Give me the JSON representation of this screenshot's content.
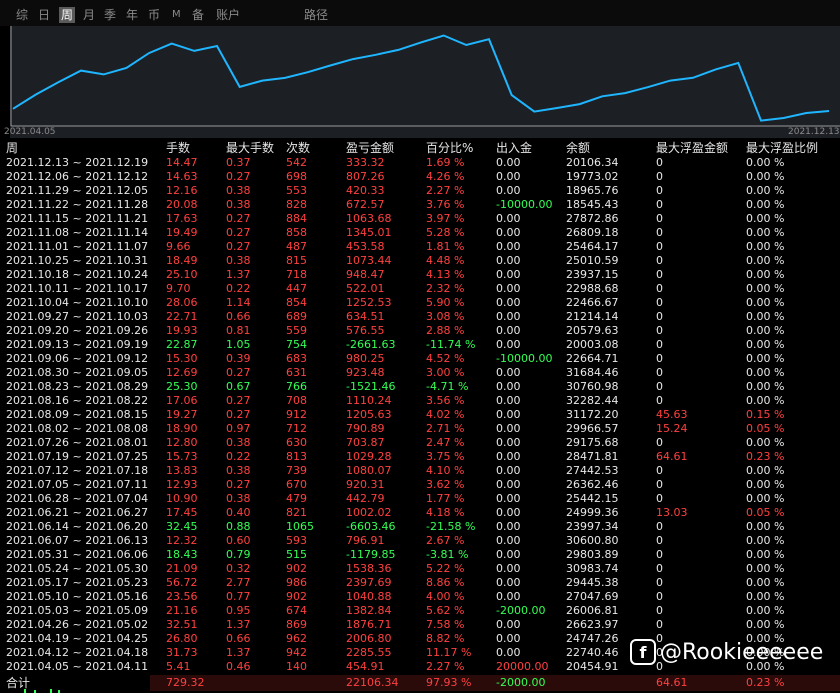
{
  "tabs": [
    {
      "label": "综",
      "active": false
    },
    {
      "label": "日",
      "active": false
    },
    {
      "label": "周",
      "active": true
    },
    {
      "label": "月",
      "active": false
    },
    {
      "label": "季",
      "active": false
    },
    {
      "label": "年",
      "active": false
    },
    {
      "label": "币",
      "active": false
    },
    {
      "label": "M",
      "active": false
    },
    {
      "label": "备",
      "active": false
    },
    {
      "label": "账户",
      "active": false
    },
    {
      "label": "路径",
      "active": false
    }
  ],
  "chart": {
    "start_label": "2021.04.05",
    "end_label": "2021.12.13",
    "line_color": "#1fb6ff",
    "balance_series": [
      20454.91,
      22740.46,
      24747.26,
      26623.97,
      26006.81,
      27047.69,
      29445.38,
      30983.74,
      29803.89,
      30600.8,
      23997.34,
      24999.36,
      25442.15,
      26362.46,
      27442.53,
      28471.81,
      29175.68,
      29966.57,
      31172.2,
      32282.44,
      30760.98,
      31684.46,
      22664.71,
      20003.08,
      20579.63,
      21214.14,
      22466.67,
      22988.68,
      23937.15,
      25010.59,
      25464.17,
      26809.18,
      27872.86,
      18545.43,
      18965.76,
      19773.02,
      20106.34
    ]
  },
  "table": {
    "headers": [
      "周",
      "手数",
      "最大手数",
      "次数",
      "盈亏金额",
      "百分比%",
      "出入金",
      "余额",
      "最大浮盈金额",
      "最大浮盈比例"
    ],
    "rows": [
      {
        "week": "2021.12.13 ~ 2021.12.19",
        "lots": "14.47",
        "max_lots": "0.37",
        "count": "542",
        "pnl": "333.32",
        "pct": "1.69 %",
        "flow": "0.00",
        "balance": "20106.34",
        "max_float": "0",
        "max_float_pct": "0.00 %",
        "tone": "red",
        "flow_tone": "white",
        "float_tone": "white"
      },
      {
        "week": "2021.12.06 ~ 2021.12.12",
        "lots": "14.63",
        "max_lots": "0.27",
        "count": "698",
        "pnl": "807.26",
        "pct": "4.26 %",
        "flow": "0.00",
        "balance": "19773.02",
        "max_float": "0",
        "max_float_pct": "0.00 %",
        "tone": "red",
        "flow_tone": "white",
        "float_tone": "white"
      },
      {
        "week": "2021.11.29 ~ 2021.12.05",
        "lots": "12.16",
        "max_lots": "0.38",
        "count": "553",
        "pnl": "420.33",
        "pct": "2.27 %",
        "flow": "0.00",
        "balance": "18965.76",
        "max_float": "0",
        "max_float_pct": "0.00 %",
        "tone": "red",
        "flow_tone": "white",
        "float_tone": "white"
      },
      {
        "week": "2021.11.22 ~ 2021.11.28",
        "lots": "20.08",
        "max_lots": "0.38",
        "count": "828",
        "pnl": "672.57",
        "pct": "3.76 %",
        "flow": "-10000.00",
        "balance": "18545.43",
        "max_float": "0",
        "max_float_pct": "0.00 %",
        "tone": "red",
        "flow_tone": "green",
        "float_tone": "white"
      },
      {
        "week": "2021.11.15 ~ 2021.11.21",
        "lots": "17.63",
        "max_lots": "0.27",
        "count": "884",
        "pnl": "1063.68",
        "pct": "3.97 %",
        "flow": "0.00",
        "balance": "27872.86",
        "max_float": "0",
        "max_float_pct": "0.00 %",
        "tone": "red",
        "flow_tone": "white",
        "float_tone": "white"
      },
      {
        "week": "2021.11.08 ~ 2021.11.14",
        "lots": "19.49",
        "max_lots": "0.27",
        "count": "858",
        "pnl": "1345.01",
        "pct": "5.28 %",
        "flow": "0.00",
        "balance": "26809.18",
        "max_float": "0",
        "max_float_pct": "0.00 %",
        "tone": "red",
        "flow_tone": "white",
        "float_tone": "white"
      },
      {
        "week": "2021.11.01 ~ 2021.11.07",
        "lots": "9.66",
        "max_lots": "0.27",
        "count": "487",
        "pnl": "453.58",
        "pct": "1.81 %",
        "flow": "0.00",
        "balance": "25464.17",
        "max_float": "0",
        "max_float_pct": "0.00 %",
        "tone": "red",
        "flow_tone": "white",
        "float_tone": "white"
      },
      {
        "week": "2021.10.25 ~ 2021.10.31",
        "lots": "18.49",
        "max_lots": "0.38",
        "count": "815",
        "pnl": "1073.44",
        "pct": "4.48 %",
        "flow": "0.00",
        "balance": "25010.59",
        "max_float": "0",
        "max_float_pct": "0.00 %",
        "tone": "red",
        "flow_tone": "white",
        "float_tone": "white"
      },
      {
        "week": "2021.10.18 ~ 2021.10.24",
        "lots": "25.10",
        "max_lots": "1.37",
        "count": "718",
        "pnl": "948.47",
        "pct": "4.13 %",
        "flow": "0.00",
        "balance": "23937.15",
        "max_float": "0",
        "max_float_pct": "0.00 %",
        "tone": "red",
        "flow_tone": "white",
        "float_tone": "white"
      },
      {
        "week": "2021.10.11 ~ 2021.10.17",
        "lots": "9.70",
        "max_lots": "0.22",
        "count": "447",
        "pnl": "522.01",
        "pct": "2.32 %",
        "flow": "0.00",
        "balance": "22988.68",
        "max_float": "0",
        "max_float_pct": "0.00 %",
        "tone": "red",
        "flow_tone": "white",
        "float_tone": "white"
      },
      {
        "week": "2021.10.04 ~ 2021.10.10",
        "lots": "28.06",
        "max_lots": "1.14",
        "count": "854",
        "pnl": "1252.53",
        "pct": "5.90 %",
        "flow": "0.00",
        "balance": "22466.67",
        "max_float": "0",
        "max_float_pct": "0.00 %",
        "tone": "red",
        "flow_tone": "white",
        "float_tone": "white"
      },
      {
        "week": "2021.09.27 ~ 2021.10.03",
        "lots": "22.71",
        "max_lots": "0.66",
        "count": "689",
        "pnl": "634.51",
        "pct": "3.08 %",
        "flow": "0.00",
        "balance": "21214.14",
        "max_float": "0",
        "max_float_pct": "0.00 %",
        "tone": "red",
        "flow_tone": "white",
        "float_tone": "white"
      },
      {
        "week": "2021.09.20 ~ 2021.09.26",
        "lots": "19.93",
        "max_lots": "0.81",
        "count": "559",
        "pnl": "576.55",
        "pct": "2.88 %",
        "flow": "0.00",
        "balance": "20579.63",
        "max_float": "0",
        "max_float_pct": "0.00 %",
        "tone": "red",
        "flow_tone": "white",
        "float_tone": "white"
      },
      {
        "week": "2021.09.13 ~ 2021.09.19",
        "lots": "22.87",
        "max_lots": "1.05",
        "count": "754",
        "pnl": "-2661.63",
        "pct": "-11.74 %",
        "flow": "0.00",
        "balance": "20003.08",
        "max_float": "0",
        "max_float_pct": "0.00 %",
        "tone": "green",
        "flow_tone": "white",
        "float_tone": "white"
      },
      {
        "week": "2021.09.06 ~ 2021.09.12",
        "lots": "15.30",
        "max_lots": "0.39",
        "count": "683",
        "pnl": "980.25",
        "pct": "4.52 %",
        "flow": "-10000.00",
        "balance": "22664.71",
        "max_float": "0",
        "max_float_pct": "0.00 %",
        "tone": "red",
        "flow_tone": "green",
        "float_tone": "white"
      },
      {
        "week": "2021.08.30 ~ 2021.09.05",
        "lots": "12.69",
        "max_lots": "0.27",
        "count": "631",
        "pnl": "923.48",
        "pct": "3.00 %",
        "flow": "0.00",
        "balance": "31684.46",
        "max_float": "0",
        "max_float_pct": "0.00 %",
        "tone": "red",
        "flow_tone": "white",
        "float_tone": "white"
      },
      {
        "week": "2021.08.23 ~ 2021.08.29",
        "lots": "25.30",
        "max_lots": "0.67",
        "count": "766",
        "pnl": "-1521.46",
        "pct": "-4.71 %",
        "flow": "0.00",
        "balance": "30760.98",
        "max_float": "0",
        "max_float_pct": "0.00 %",
        "tone": "green",
        "flow_tone": "white",
        "float_tone": "white"
      },
      {
        "week": "2021.08.16 ~ 2021.08.22",
        "lots": "17.06",
        "max_lots": "0.27",
        "count": "708",
        "pnl": "1110.24",
        "pct": "3.56 %",
        "flow": "0.00",
        "balance": "32282.44",
        "max_float": "0",
        "max_float_pct": "0.00 %",
        "tone": "red",
        "flow_tone": "white",
        "float_tone": "white"
      },
      {
        "week": "2021.08.09 ~ 2021.08.15",
        "lots": "19.27",
        "max_lots": "0.27",
        "count": "912",
        "pnl": "1205.63",
        "pct": "4.02 %",
        "flow": "0.00",
        "balance": "31172.20",
        "max_float": "45.63",
        "max_float_pct": "0.15 %",
        "tone": "red",
        "flow_tone": "white",
        "float_tone": "red"
      },
      {
        "week": "2021.08.02 ~ 2021.08.08",
        "lots": "18.90",
        "max_lots": "0.97",
        "count": "712",
        "pnl": "790.89",
        "pct": "2.71 %",
        "flow": "0.00",
        "balance": "29966.57",
        "max_float": "15.24",
        "max_float_pct": "0.05 %",
        "tone": "red",
        "flow_tone": "white",
        "float_tone": "red"
      },
      {
        "week": "2021.07.26 ~ 2021.08.01",
        "lots": "12.80",
        "max_lots": "0.38",
        "count": "630",
        "pnl": "703.87",
        "pct": "2.47 %",
        "flow": "0.00",
        "balance": "29175.68",
        "max_float": "0",
        "max_float_pct": "0.00 %",
        "tone": "red",
        "flow_tone": "white",
        "float_tone": "white"
      },
      {
        "week": "2021.07.19 ~ 2021.07.25",
        "lots": "15.73",
        "max_lots": "0.22",
        "count": "813",
        "pnl": "1029.28",
        "pct": "3.75 %",
        "flow": "0.00",
        "balance": "28471.81",
        "max_float": "64.61",
        "max_float_pct": "0.23 %",
        "tone": "red",
        "flow_tone": "white",
        "float_tone": "red"
      },
      {
        "week": "2021.07.12 ~ 2021.07.18",
        "lots": "13.83",
        "max_lots": "0.38",
        "count": "739",
        "pnl": "1080.07",
        "pct": "4.10 %",
        "flow": "0.00",
        "balance": "27442.53",
        "max_float": "0",
        "max_float_pct": "0.00 %",
        "tone": "red",
        "flow_tone": "white",
        "float_tone": "white"
      },
      {
        "week": "2021.07.05 ~ 2021.07.11",
        "lots": "12.93",
        "max_lots": "0.27",
        "count": "670",
        "pnl": "920.31",
        "pct": "3.62 %",
        "flow": "0.00",
        "balance": "26362.46",
        "max_float": "0",
        "max_float_pct": "0.00 %",
        "tone": "red",
        "flow_tone": "white",
        "float_tone": "white"
      },
      {
        "week": "2021.06.28 ~ 2021.07.04",
        "lots": "10.90",
        "max_lots": "0.38",
        "count": "479",
        "pnl": "442.79",
        "pct": "1.77 %",
        "flow": "0.00",
        "balance": "25442.15",
        "max_float": "0",
        "max_float_pct": "0.00 %",
        "tone": "red",
        "flow_tone": "white",
        "float_tone": "white"
      },
      {
        "week": "2021.06.21 ~ 2021.06.27",
        "lots": "17.45",
        "max_lots": "0.40",
        "count": "821",
        "pnl": "1002.02",
        "pct": "4.18 %",
        "flow": "0.00",
        "balance": "24999.36",
        "max_float": "13.03",
        "max_float_pct": "0.05 %",
        "tone": "red",
        "flow_tone": "white",
        "float_tone": "red"
      },
      {
        "week": "2021.06.14 ~ 2021.06.20",
        "lots": "32.45",
        "max_lots": "0.88",
        "count": "1065",
        "pnl": "-6603.46",
        "pct": "-21.58 %",
        "flow": "0.00",
        "balance": "23997.34",
        "max_float": "0",
        "max_float_pct": "0.00 %",
        "tone": "green",
        "flow_tone": "white",
        "float_tone": "white"
      },
      {
        "week": "2021.06.07 ~ 2021.06.13",
        "lots": "12.32",
        "max_lots": "0.60",
        "count": "593",
        "pnl": "796.91",
        "pct": "2.67 %",
        "flow": "0.00",
        "balance": "30600.80",
        "max_float": "0",
        "max_float_pct": "0.00 %",
        "tone": "red",
        "flow_tone": "white",
        "float_tone": "white"
      },
      {
        "week": "2021.05.31 ~ 2021.06.06",
        "lots": "18.43",
        "max_lots": "0.79",
        "count": "515",
        "pnl": "-1179.85",
        "pct": "-3.81 %",
        "flow": "0.00",
        "balance": "29803.89",
        "max_float": "0",
        "max_float_pct": "0.00 %",
        "tone": "green",
        "flow_tone": "white",
        "float_tone": "white"
      },
      {
        "week": "2021.05.24 ~ 2021.05.30",
        "lots": "21.09",
        "max_lots": "0.32",
        "count": "902",
        "pnl": "1538.36",
        "pct": "5.22 %",
        "flow": "0.00",
        "balance": "30983.74",
        "max_float": "0",
        "max_float_pct": "0.00 %",
        "tone": "red",
        "flow_tone": "white",
        "float_tone": "white"
      },
      {
        "week": "2021.05.17 ~ 2021.05.23",
        "lots": "56.72",
        "max_lots": "2.77",
        "count": "986",
        "pnl": "2397.69",
        "pct": "8.86 %",
        "flow": "0.00",
        "balance": "29445.38",
        "max_float": "0",
        "max_float_pct": "0.00 %",
        "tone": "red",
        "flow_tone": "white",
        "float_tone": "white"
      },
      {
        "week": "2021.05.10 ~ 2021.05.16",
        "lots": "23.56",
        "max_lots": "0.77",
        "count": "902",
        "pnl": "1040.88",
        "pct": "4.00 %",
        "flow": "0.00",
        "balance": "27047.69",
        "max_float": "0",
        "max_float_pct": "0.00 %",
        "tone": "red",
        "flow_tone": "white",
        "float_tone": "white"
      },
      {
        "week": "2021.05.03 ~ 2021.05.09",
        "lots": "21.16",
        "max_lots": "0.95",
        "count": "674",
        "pnl": "1382.84",
        "pct": "5.62 %",
        "flow": "-2000.00",
        "balance": "26006.81",
        "max_float": "0",
        "max_float_pct": "0.00 %",
        "tone": "red",
        "flow_tone": "green",
        "float_tone": "white"
      },
      {
        "week": "2021.04.26 ~ 2021.05.02",
        "lots": "32.51",
        "max_lots": "1.37",
        "count": "869",
        "pnl": "1876.71",
        "pct": "7.58 %",
        "flow": "0.00",
        "balance": "26623.97",
        "max_float": "0",
        "max_float_pct": "0.00 %",
        "tone": "red",
        "flow_tone": "white",
        "float_tone": "white"
      },
      {
        "week": "2021.04.19 ~ 2021.04.25",
        "lots": "26.80",
        "max_lots": "0.66",
        "count": "962",
        "pnl": "2006.80",
        "pct": "8.82 %",
        "flow": "0.00",
        "balance": "24747.26",
        "max_float": "0",
        "max_float_pct": "0.00 %",
        "tone": "red",
        "flow_tone": "white",
        "float_tone": "white"
      },
      {
        "week": "2021.04.12 ~ 2021.04.18",
        "lots": "31.73",
        "max_lots": "1.37",
        "count": "942",
        "pnl": "2285.55",
        "pct": "11.17 %",
        "flow": "0.00",
        "balance": "22740.46",
        "max_float": "0",
        "max_float_pct": "0.00 %",
        "tone": "red",
        "flow_tone": "white",
        "float_tone": "white"
      },
      {
        "week": "2021.04.05 ~ 2021.04.11",
        "lots": "5.41",
        "max_lots": "0.46",
        "count": "140",
        "pnl": "454.91",
        "pct": "2.27 %",
        "flow": "20000.00",
        "balance": "20454.91",
        "max_float": "0",
        "max_float_pct": "0.00 %",
        "tone": "red",
        "flow_tone": "red",
        "float_tone": "white"
      }
    ],
    "total": {
      "label": "合计",
      "lots": "729.32",
      "pnl": "22106.34",
      "pct": "97.93 %",
      "flow": "-2000.00",
      "max_float": "64.61",
      "max_float_pct": "0.23 %"
    }
  },
  "watermark": {
    "icon": "f",
    "text": "@Rookieeeeee"
  },
  "colors": {
    "profit": "#ff4040",
    "loss": "#33ff55",
    "line": "#1fb6ff",
    "panel": "#1c1f24"
  }
}
